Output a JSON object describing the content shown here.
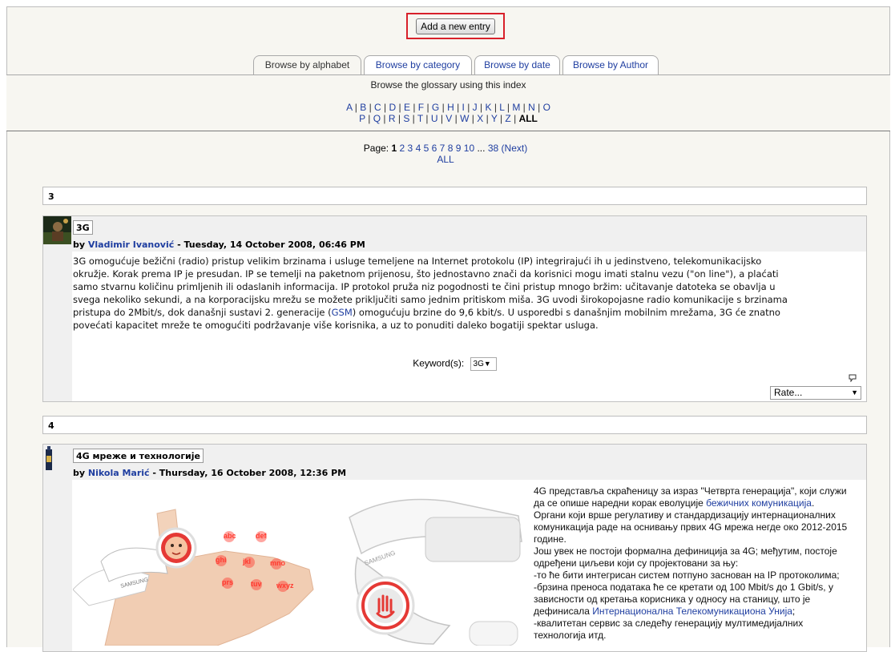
{
  "actions": {
    "add_entry": "Add a new entry"
  },
  "tabs": [
    {
      "label": "Browse by alphabet",
      "active": true
    },
    {
      "label": "Browse by category"
    },
    {
      "label": "Browse by date"
    },
    {
      "label": "Browse by Author"
    }
  ],
  "index": {
    "title": "Browse the glossary using this index",
    "row1": [
      "A",
      "B",
      "C",
      "D",
      "E",
      "F",
      "G",
      "H",
      "I",
      "J",
      "K",
      "L",
      "M",
      "N",
      "O"
    ],
    "row2": [
      "P",
      "Q",
      "R",
      "S",
      "T",
      "U",
      "V",
      "W",
      "X",
      "Y",
      "Z"
    ],
    "all": "ALL"
  },
  "paging": {
    "label": "Page:",
    "current": "1",
    "pages": [
      "2",
      "3",
      "4",
      "5",
      "6",
      "7",
      "8",
      "9",
      "10"
    ],
    "ellipsis": "...",
    "last": "38",
    "next_open": "(",
    "next": "Next",
    "next_close": ")",
    "all": "ALL"
  },
  "sections": [
    {
      "letter": "3"
    },
    {
      "letter": "4"
    }
  ],
  "entries": [
    {
      "concept": "3G",
      "by": "by",
      "author": "Vladimir Ivanović",
      "date": " - Tuesday, 14 October 2008, 06:46 PM",
      "definition_lines": [
        "3G omogućuje bežični (radio) pristup velikim brzinama i usluge temeljene na Internet protokolu (IP) integrirajući ih u jedinstveno, telekomunikacijsko",
        "okružje. Korak prema IP je presudan. IP se temelji na paketnom prijenosu, što jednostavno znači da korisnici mogu imati stalnu vezu (\"on line\"), a plaćati",
        "samo stvarnu količinu primljenih ili odaslanih informacija. IP protokol pruža niz pogodnosti te čini pristup mnogo bržim: učitavanje datoteka se obavlja u",
        "svega nekoliko sekundi, a na korporacijsku mrežu se možete priključiti samo jednim pritiskom miša. 3G uvodi širokopojasne radio komunikacije s brzinama",
        "pristupa do 2Mbit/s, dok današnji sustavi 2. generacije ("
      ],
      "gsm_link": "GSM",
      "line5_rest": ") omogućuju brzine do 9,6 kbit/s. U usporedbi s današnjim mobilnim mrežama, 3G će znatno",
      "line6": "povećati kapacitet mreže te omogućiti podržavanje više korisnika, a uz to ponuditi daleko bogatiji spektar usluga.",
      "keywords_label": "Keyword(s):",
      "keyword": "3G",
      "rate_label": "Rate..."
    },
    {
      "concept": "4G мреже и технологије",
      "by": "by",
      "author": "Nikola Marić",
      "date": " - Thursday, 16 October 2008, 12:36 PM",
      "text": {
        "l1": "4G представља скраћеницу за израз \"Четврта генерација\", који служи",
        "l2a": "да се опише наредни корак еволуције ",
        "l2link": "бежичних комуникација",
        "l2b": ".",
        "l3": "Органи који врше регулативу и стандардизацију интернационалних",
        "l4": "комуникација раде на оснивању првих 4G мрежа негде око 2012-2015",
        "l5": "године.",
        "l6": "Још увек не постоји формална дефиниција за 4G; међутим, постоје",
        "l7": "одређени циљеви који су пројектовани за њу:",
        "l8": "-то ће бити интегрисан систем потпуно заснован на IP протоколима;",
        "l9": "-брзина преноса података ће се кретати од 100 Mbit/s до 1 Gbit/s, у",
        "l10": "зависности од кретања корисника у односу на станицу, што је",
        "l11a": "дефинисала ",
        "l11link": "Интернационална Телекомуникациона Унија",
        "l11b": ";",
        "l12": "-квалитетан сервис за следећу генерацију мултимедијалних",
        "l13": "технологија итд."
      },
      "image_texts": {
        "key1": "abc",
        "key2": "def",
        "key3": "ghi",
        "key4": "jkl",
        "key5": "mno",
        "key6": "prs",
        "key7": "tuv",
        "key8": "wxyz",
        "brand1": "SAMSUNG",
        "brand2": "SAMSUNG"
      }
    }
  ]
}
